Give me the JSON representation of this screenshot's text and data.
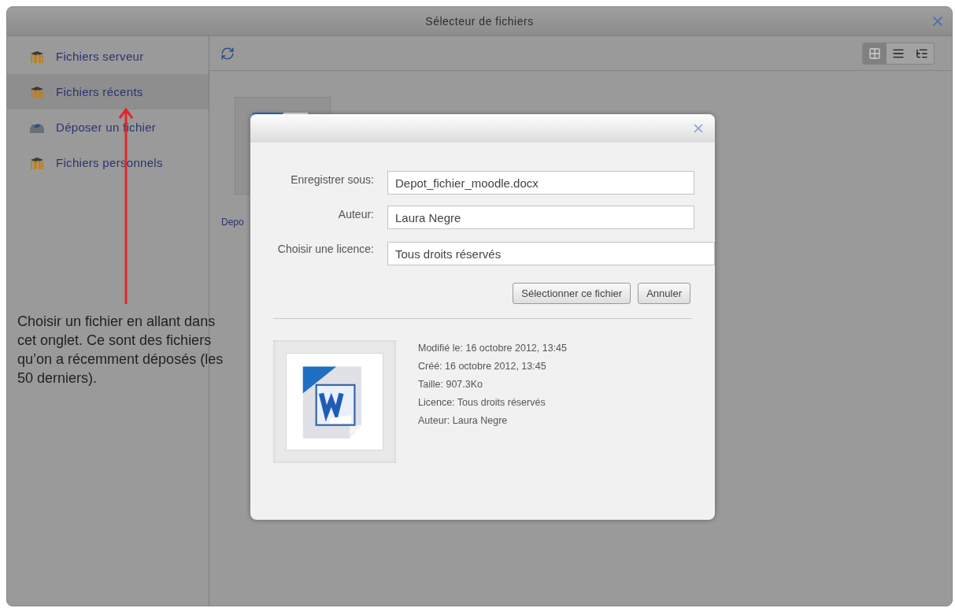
{
  "window": {
    "title": "Sélecteur de fichiers"
  },
  "sidebar": {
    "items": [
      {
        "label": "Fichiers serveur",
        "kind": "repository",
        "selected": false
      },
      {
        "label": "Fichiers récents",
        "kind": "repository",
        "selected": true
      },
      {
        "label": "Déposer un fichier",
        "kind": "upload",
        "selected": false
      },
      {
        "label": "Fichiers personnels",
        "kind": "repository",
        "selected": false
      }
    ]
  },
  "toolbar": {
    "view_modes": [
      {
        "kind": "icons",
        "selected": true
      },
      {
        "kind": "list",
        "selected": false
      },
      {
        "kind": "tree",
        "selected": false
      }
    ]
  },
  "files": [
    {
      "name": "Depo"
    }
  ],
  "dialog": {
    "fields": [
      {
        "label": "Enregistrer sous:",
        "value": "Depot_fichier_moodle.docx",
        "kind": "text"
      },
      {
        "label": "Auteur:",
        "value": "Laura Negre",
        "kind": "text"
      },
      {
        "label": "Choisir une licence:",
        "value": "Tous droits réservés",
        "kind": "select"
      }
    ],
    "buttons": [
      "Sélectionner ce fichier",
      "Annuler"
    ],
    "details": [
      "Modifié le: 16 octobre 2012, 13:45",
      "Créé: 16 octobre 2012, 13:45",
      "Taille: 907.3Ko",
      "Licence: Tous droits réservés",
      "Auteur: Laura Negre"
    ]
  },
  "annotation": {
    "text": "Choisir un fichier en allant dans cet onglet. Ce sont des fichiers qu’on a récemment déposés (les 50 derniers)."
  }
}
